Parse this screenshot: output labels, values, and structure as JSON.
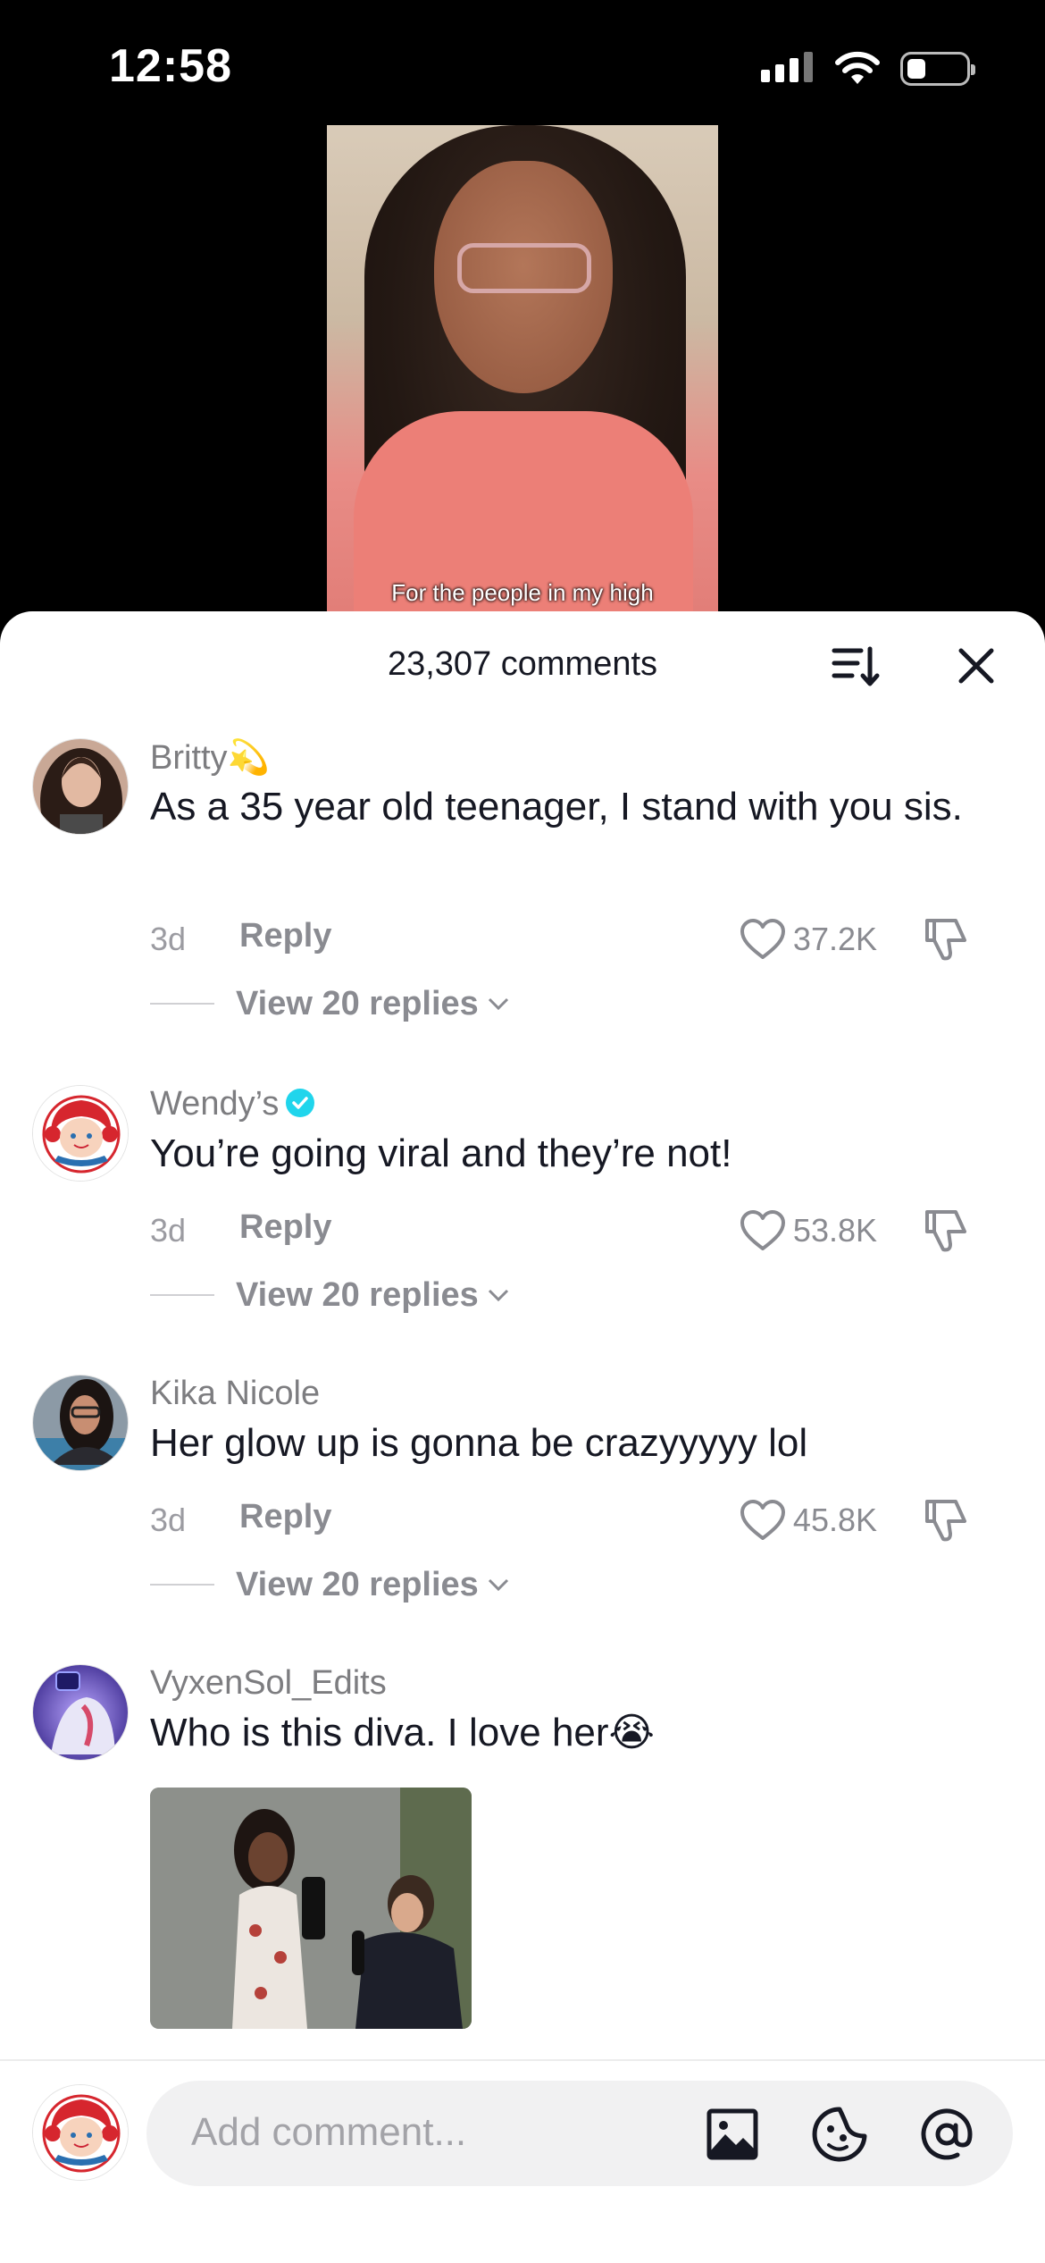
{
  "status_bar": {
    "time": "12:58"
  },
  "video": {
    "caption": "For the people in my high"
  },
  "sheet": {
    "comments_count": "23,307 comments"
  },
  "comments": [
    {
      "user": "Britty💫",
      "text": "As a 35 year old teenager, I stand with you sis.",
      "age": "3d",
      "reply": "Reply",
      "likes": "37.2K",
      "view_replies": "View 20 replies"
    },
    {
      "user": "Wendy’s",
      "text": "You’re going viral and they’re not!",
      "age": "3d",
      "reply": "Reply",
      "likes": "53.8K",
      "view_replies": "View 20 replies",
      "verified": true
    },
    {
      "user": "Kika Nicole",
      "text": "Her glow up is gonna be crazyyyyy lol",
      "age": "3d",
      "reply": "Reply",
      "likes": "45.8K",
      "view_replies": "View 20 replies"
    },
    {
      "user": "VyxenSol_Edits",
      "text": "Who is this diva. I love her😭"
    }
  ],
  "composer": {
    "placeholder": "Add comment..."
  },
  "colors": {
    "verified": "#20d5ec",
    "text_primary": "#161823",
    "text_secondary": "#8a8b91",
    "wendys_red": "#d6262e"
  }
}
